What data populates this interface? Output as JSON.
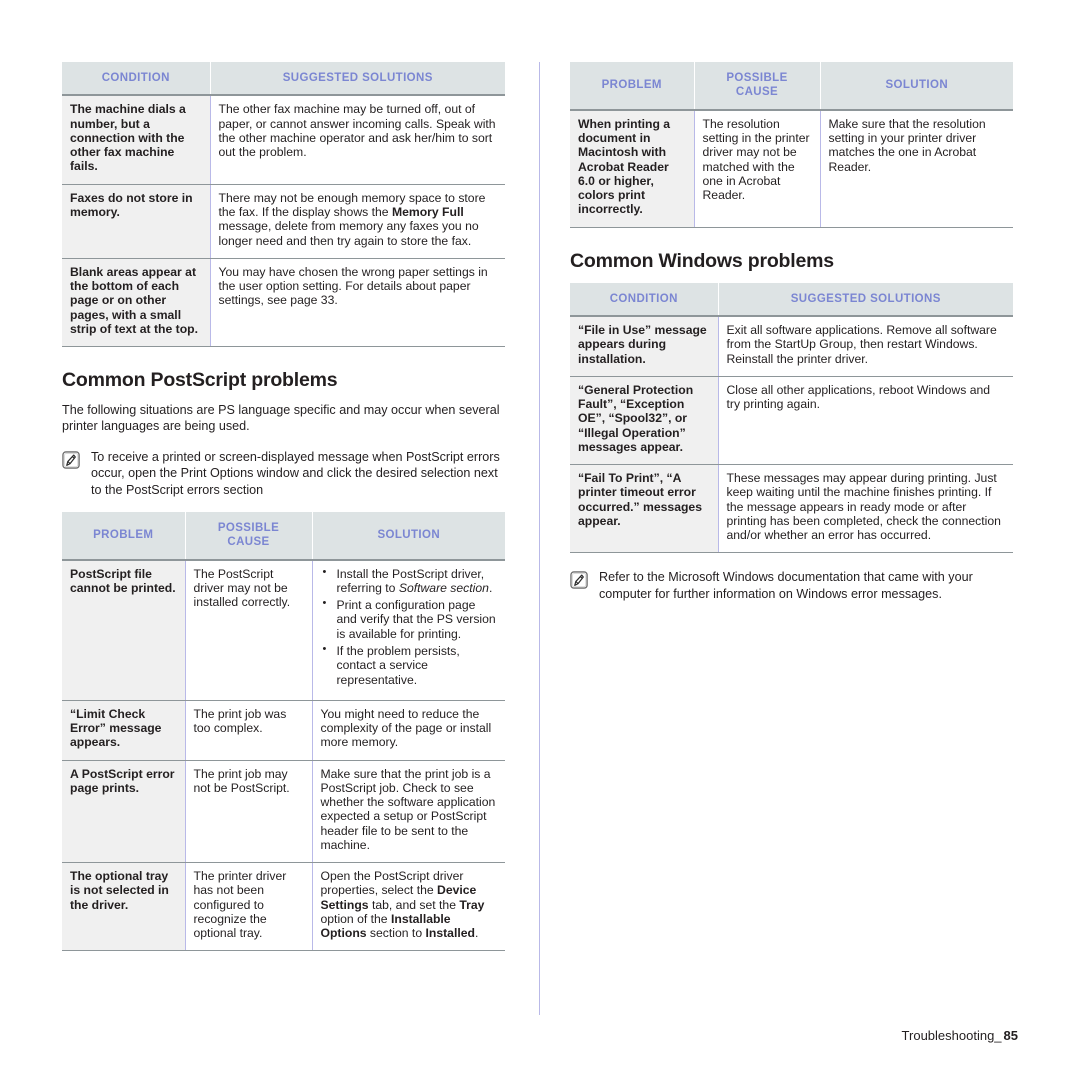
{
  "footer": {
    "label": "Troubleshooting_",
    "page": "85"
  },
  "icons": {
    "note": "note-pencil-icon"
  },
  "colors": {
    "header_bg": "#dde3e4",
    "header_text": "#7b86d2",
    "key_cell_bg": "#f0f0f0",
    "rule": "#8e9699",
    "divider": "#b9b9e8",
    "body_text": "#231f20"
  },
  "left_column": {
    "fax_table": {
      "headers": [
        "CONDITION",
        "SUGGESTED SOLUTIONS"
      ],
      "rows": [
        {
          "condition": "The machine dials a number, but a connection with the other fax machine fails.",
          "solution_parts": [
            {
              "t": "The other fax machine may be turned off, out of paper, or cannot answer incoming calls. Speak with the other machine operator and ask her/him to sort out the problem.",
              "s": "n"
            }
          ]
        },
        {
          "condition": "Faxes do not store in memory.",
          "solution_parts": [
            {
              "t": "There may not be enough memory space to store the fax. If the display shows the ",
              "s": "n"
            },
            {
              "t": "Memory Full",
              "s": "b"
            },
            {
              "t": " message, delete from memory any faxes you no longer need and then try again to store the fax.",
              "s": "n"
            }
          ]
        },
        {
          "condition": "Blank areas appear at the bottom of each page or on other pages, with a small strip of text at the top.",
          "solution_parts": [
            {
              "t": "You may have chosen the wrong paper settings in the user option setting. For details about paper settings, see page 33.",
              "s": "n"
            }
          ]
        }
      ]
    },
    "postscript_section": {
      "heading": "Common PostScript problems",
      "intro": "The following situations are PS language specific and may occur when several printer languages are being used.",
      "note": "To receive a printed or screen-displayed message when PostScript errors occur, open the Print Options window and click the desired selection next to the PostScript errors section",
      "table": {
        "headers": [
          "PROBLEM",
          "POSSIBLE CAUSE",
          "SOLUTION"
        ],
        "headers_multiline": [
          [
            "PROBLEM"
          ],
          [
            "POSSIBLE",
            "CAUSE"
          ],
          [
            "SOLUTION"
          ]
        ],
        "rows": [
          {
            "problem": "PostScript file cannot be printed.",
            "cause": "The PostScript driver may not be installed correctly.",
            "solution_bullets": [
              [
                {
                  "t": "Install the PostScript driver, referring to ",
                  "s": "n"
                },
                {
                  "t": "Software section",
                  "s": "i"
                },
                {
                  "t": ".",
                  "s": "n"
                }
              ],
              [
                {
                  "t": "Print a configuration page and verify that the PS version is available for printing.",
                  "s": "n"
                }
              ],
              [
                {
                  "t": "If the problem persists, contact a service representative.",
                  "s": "n"
                }
              ]
            ]
          },
          {
            "problem": "“Limit Check Error” message appears.",
            "cause": "The print job was too complex.",
            "solution_parts": [
              {
                "t": "You might need to reduce the complexity of the page or install more memory.",
                "s": "n"
              }
            ]
          },
          {
            "problem": "A PostScript error page prints.",
            "cause": "The print job may not be PostScript.",
            "solution_parts": [
              {
                "t": "Make sure that the print job is a PostScript job. Check to see whether the software application expected a setup or PostScript header file to be sent to the machine.",
                "s": "n"
              }
            ]
          },
          {
            "problem": "The optional tray is not selected in the driver.",
            "cause": "The printer driver has not been configured to recognize the optional tray.",
            "solution_parts": [
              {
                "t": "Open the PostScript driver properties, select the ",
                "s": "n"
              },
              {
                "t": "Device Settings",
                "s": "b"
              },
              {
                "t": " tab, and set the ",
                "s": "n"
              },
              {
                "t": "Tray",
                "s": "b"
              },
              {
                "t": " option of the ",
                "s": "n"
              },
              {
                "t": "Installable Options",
                "s": "b"
              },
              {
                "t": " section to ",
                "s": "n"
              },
              {
                "t": "Installed",
                "s": "b"
              },
              {
                "t": ".",
                "s": "n"
              }
            ]
          }
        ]
      }
    }
  },
  "right_column": {
    "macintosh_table": {
      "headers_multiline": [
        [
          "PROBLEM"
        ],
        [
          "POSSIBLE",
          "CAUSE"
        ],
        [
          "SOLUTION"
        ]
      ],
      "rows": [
        {
          "problem": "When printing a document in Macintosh with Acrobat Reader 6.0 or higher, colors print incorrectly.",
          "cause": "The resolution setting in the printer driver may not be matched with the one in Acrobat Reader.",
          "solution_parts": [
            {
              "t": "Make sure that the resolution setting in your printer driver matches the one in Acrobat Reader.",
              "s": "n"
            }
          ]
        }
      ]
    },
    "windows_section": {
      "heading": "Common Windows problems",
      "table": {
        "headers": [
          "CONDITION",
          "SUGGESTED SOLUTIONS"
        ],
        "rows": [
          {
            "condition": "“File in Use” message appears during installation.",
            "solution_parts": [
              {
                "t": "Exit all software applications. Remove all software from the StartUp Group, then restart Windows. Reinstall the printer driver.",
                "s": "n"
              }
            ]
          },
          {
            "condition": "“General Protection Fault”, “Exception OE”, “Spool32”, or “Illegal Operation” messages appear.",
            "solution_parts": [
              {
                "t": "Close all other applications, reboot Windows and try printing again.",
                "s": "n"
              }
            ]
          },
          {
            "condition": "“Fail To Print”, “A printer timeout error occurred.” messages appear.",
            "solution_parts": [
              {
                "t": "These messages may appear during printing. Just keep waiting until the machine finishes printing. If the message appears in ready mode or after printing has been completed, check the connection and/or whether an error has occurred.",
                "s": "n"
              }
            ]
          }
        ]
      },
      "note": "Refer to the Microsoft Windows documentation that came with your computer for further information on Windows error messages."
    }
  }
}
